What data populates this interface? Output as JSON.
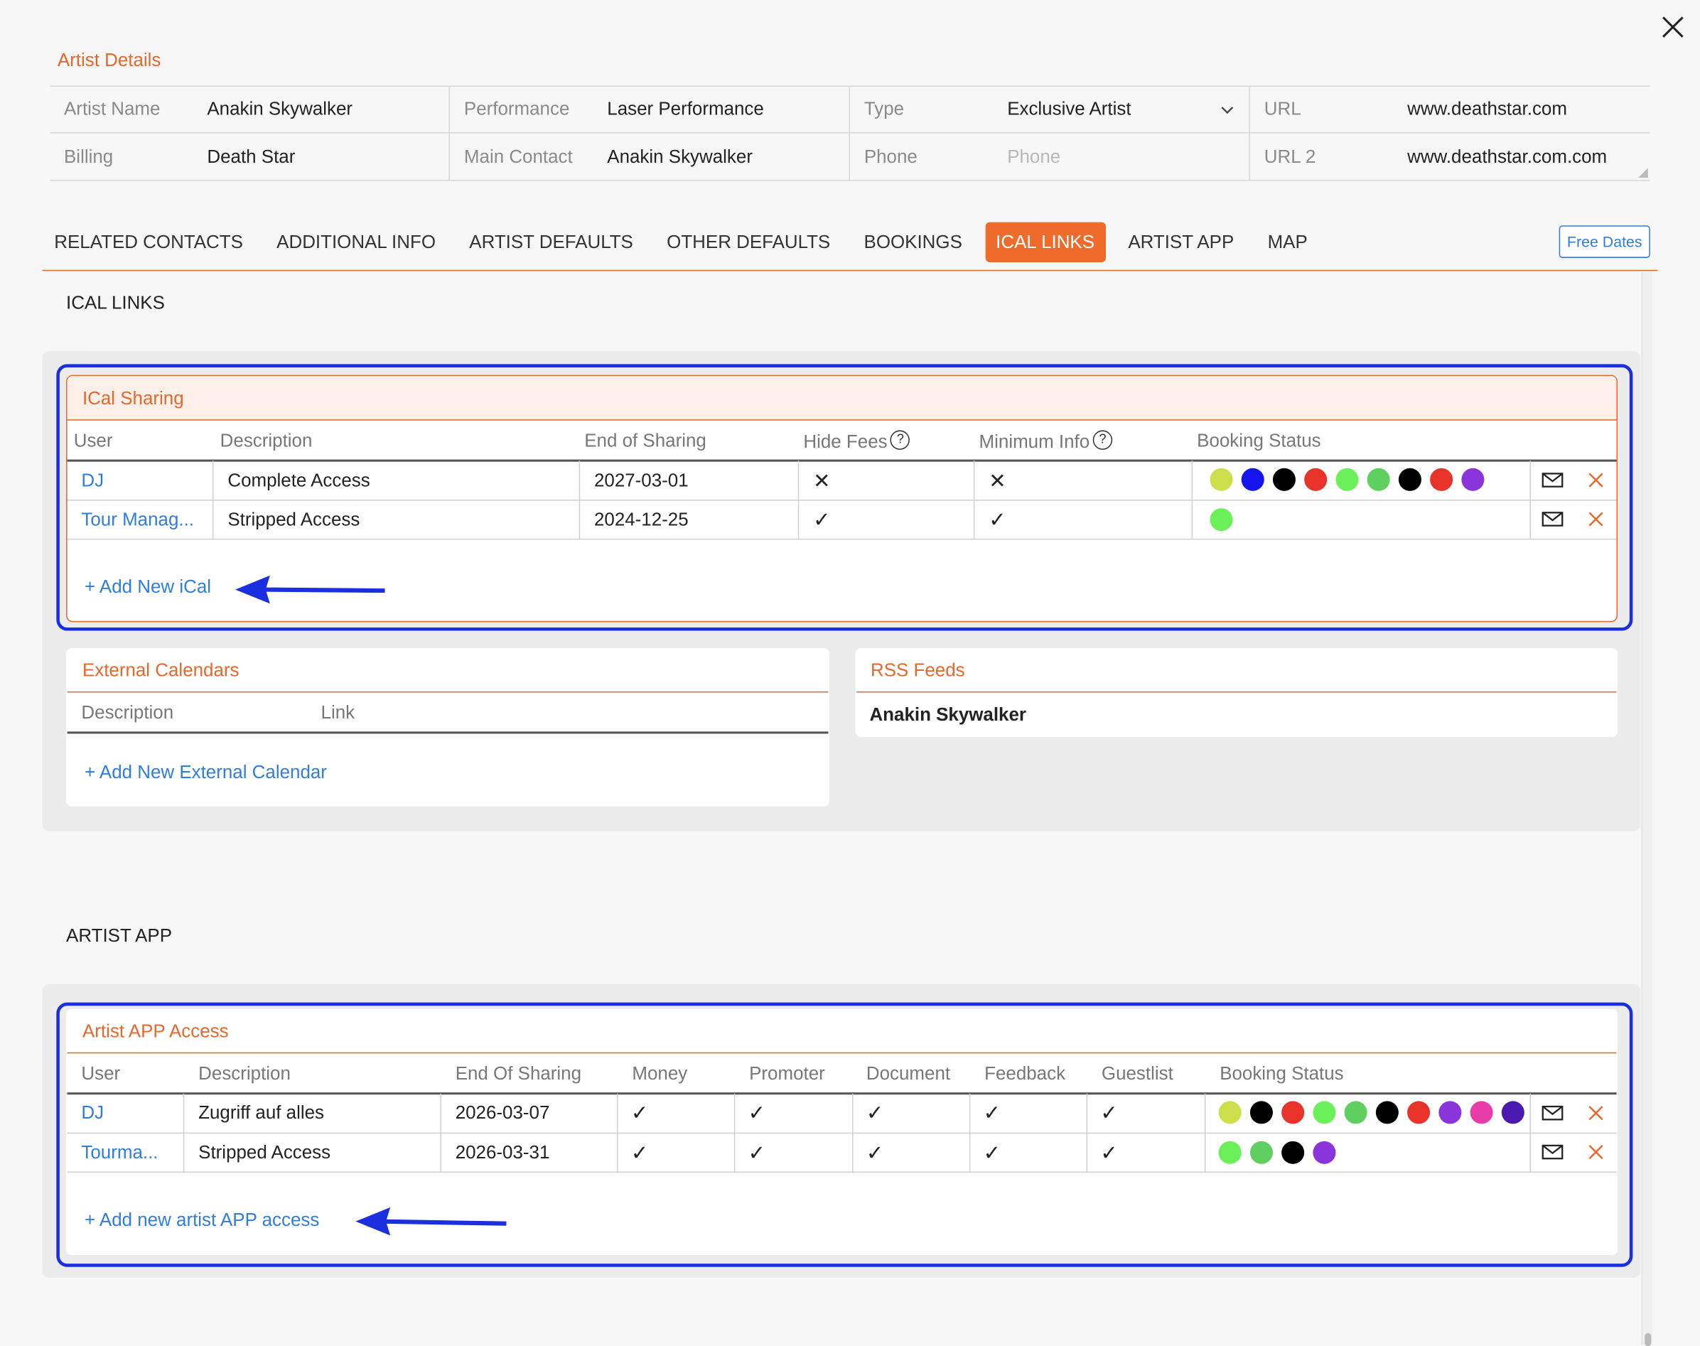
{
  "dialog": {
    "close_label": "close"
  },
  "artist_details": {
    "title": "Artist Details",
    "fields": [
      {
        "label": "Artist Name",
        "value": "Anakin Skywalker"
      },
      {
        "label": "Performance",
        "value": "Laser Performance"
      },
      {
        "label": "Type",
        "value": "Exclusive Artist"
      },
      {
        "label": "URL",
        "value": "www.deathstar.com"
      },
      {
        "label": "Billing",
        "value": "Death Star"
      },
      {
        "label": "Main Contact",
        "value": "Anakin Skywalker"
      },
      {
        "label": "Phone",
        "placeholder": "Phone"
      },
      {
        "label": "URL 2",
        "value": "www.deathstar.com.com"
      }
    ]
  },
  "tabs": [
    {
      "label": "RELATED CONTACTS"
    },
    {
      "label": "ADDITIONAL INFO"
    },
    {
      "label": "ARTIST DEFAULTS"
    },
    {
      "label": "OTHER DEFAULTS"
    },
    {
      "label": "BOOKINGS"
    },
    {
      "label": "ICAL LINKS",
      "active": true
    },
    {
      "label": "ARTIST APP"
    },
    {
      "label": "MAP"
    }
  ],
  "free_dates_label": "Free Dates",
  "ical_section": {
    "heading": "ICAL LINKS",
    "sharing": {
      "title": "ICal Sharing",
      "columns": [
        "User",
        "Description",
        "End of Sharing",
        "Hide Fees",
        "Minimum Info",
        "Booking Status"
      ],
      "help_glyph": "?",
      "rows": [
        {
          "user": "DJ",
          "description": "Complete Access",
          "end": "2027-03-01",
          "hide_fees": "✕",
          "minimum_info": "✕",
          "status_colors": [
            "#cde04c",
            "#1414ee",
            "#000000",
            "#e8332a",
            "#6cf05a",
            "#5fd060",
            "#000000",
            "#e8332a",
            "#8a35dc"
          ]
        },
        {
          "user": "Tour Manag...",
          "description": "Stripped Access",
          "end": "2024-12-25",
          "hide_fees": "✓",
          "minimum_info": "✓",
          "status_colors": [
            "#6cf05a"
          ]
        }
      ],
      "add_label": "+ Add New iCal"
    },
    "external": {
      "title": "External Calendars",
      "columns": [
        "Description",
        "Link"
      ],
      "add_label": "+ Add New External Calendar"
    },
    "rss": {
      "title": "RSS Feeds",
      "item": "Anakin Skywalker"
    }
  },
  "artist_app_section": {
    "heading": "ARTIST APP",
    "access": {
      "title": "Artist APP Access",
      "columns": [
        "User",
        "Description",
        "End Of Sharing",
        "Money",
        "Promoter",
        "Document",
        "Feedback",
        "Guestlist",
        "Booking Status"
      ],
      "rows": [
        {
          "user": "DJ",
          "description": "Zugriff auf alles",
          "end": "2026-03-07",
          "checks": [
            "✓",
            "✓",
            "✓",
            "✓",
            "✓"
          ],
          "status_colors": [
            "#cde04c",
            "#000000",
            "#e8332a",
            "#6cf05a",
            "#5fd060",
            "#000000",
            "#e8332a",
            "#8a35dc",
            "#e83ca8",
            "#4a1ab0"
          ]
        },
        {
          "user": "Tourma...",
          "description": "Stripped Access",
          "end": "2026-03-31",
          "checks": [
            "✓",
            "✓",
            "✓",
            "✓",
            "✓"
          ],
          "status_colors": [
            "#6cf05a",
            "#5fd060",
            "#000000",
            "#8a35dc"
          ]
        }
      ],
      "add_label": "+ Add new artist APP access"
    }
  },
  "colors": {
    "accent": "#e8672a",
    "link": "#2f7de1",
    "highlight_frame": "#1a2fe0"
  },
  "icons": {
    "mail": "mail-icon",
    "delete": "delete-icon",
    "close": "close-icon",
    "chevron": "chevron-down-icon",
    "help": "help-icon",
    "arrow": "arrow-left-icon"
  }
}
